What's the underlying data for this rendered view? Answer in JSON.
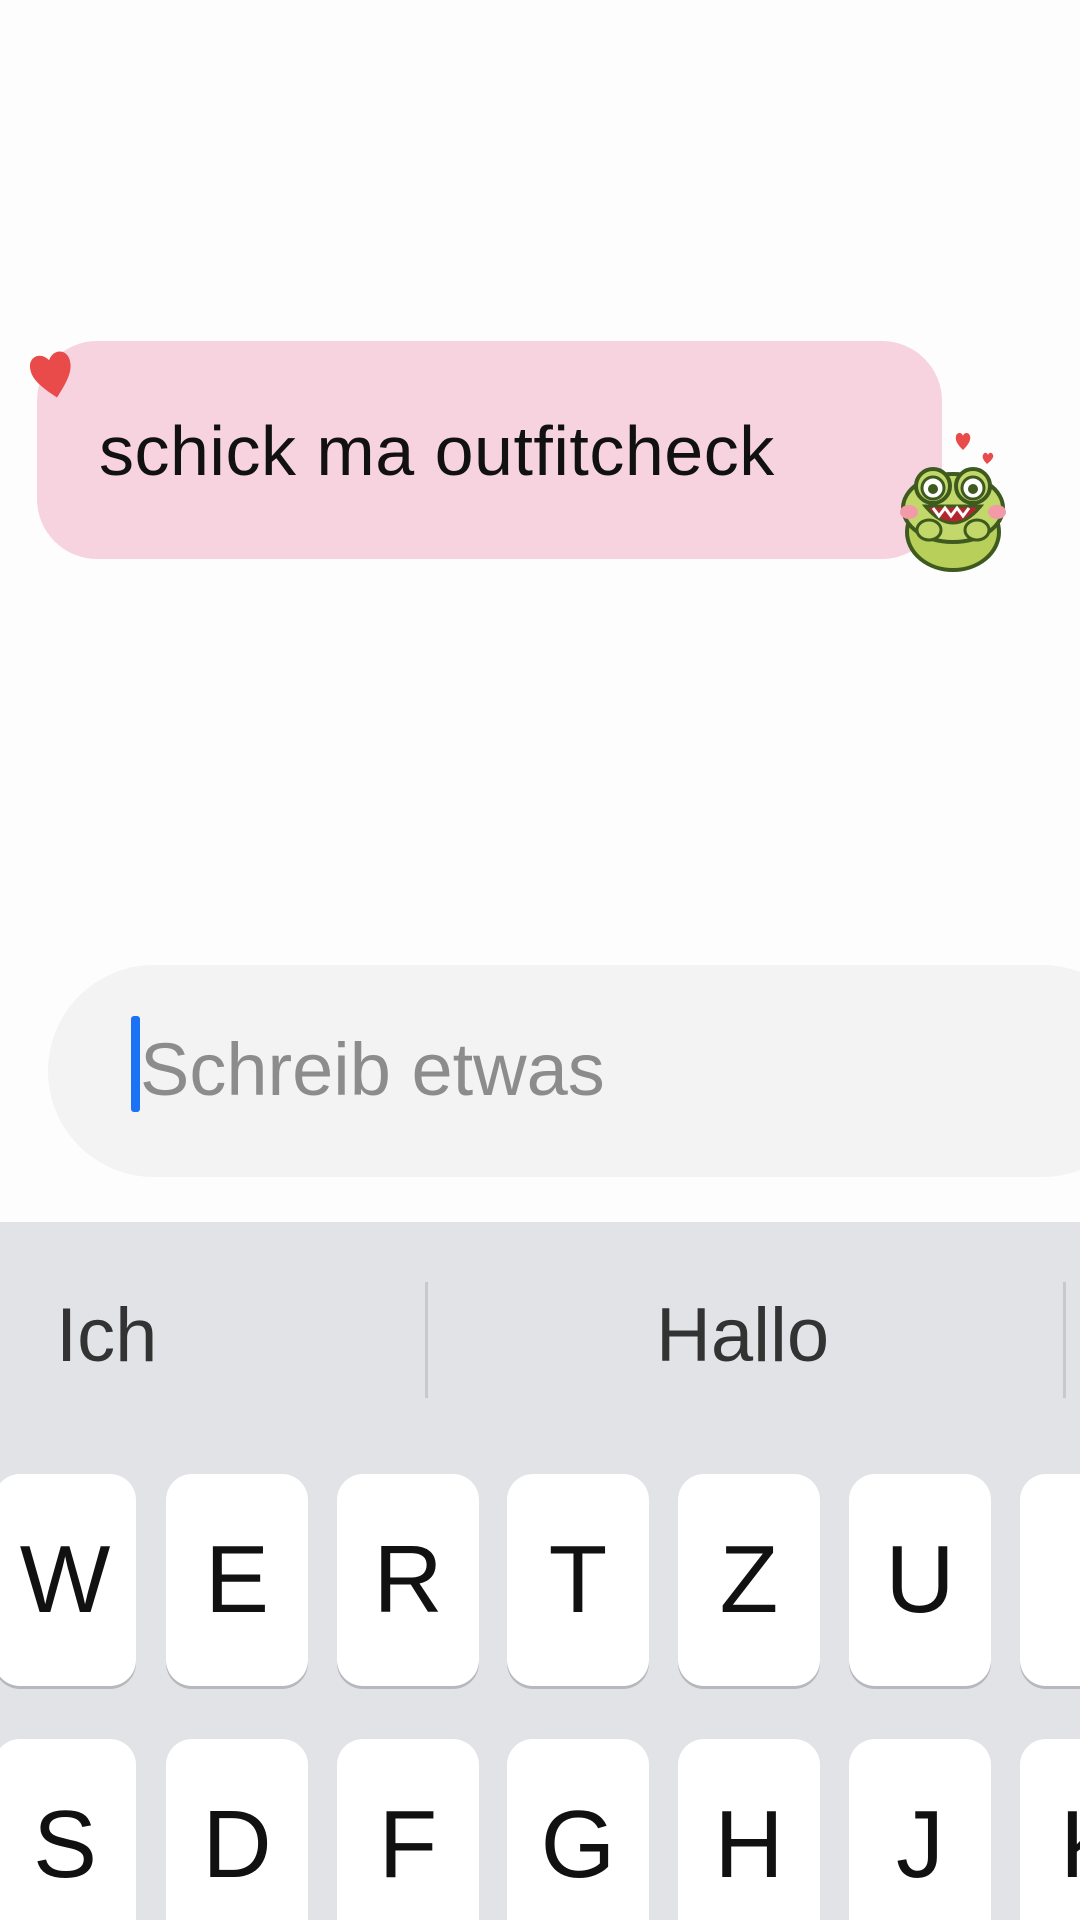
{
  "chat": {
    "message": "schick ma outfitcheck"
  },
  "composer": {
    "placeholder": "Schreib etwas"
  },
  "keyboard": {
    "suggestions": [
      "Ich",
      "Hallo"
    ],
    "row1": [
      "W",
      "E",
      "R",
      "T",
      "Z",
      "U",
      ""
    ],
    "row2": [
      "S",
      "D",
      "F",
      "G",
      "H",
      "J",
      "K"
    ]
  },
  "colors": {
    "bubble": "#f7d3e0",
    "caret": "#1a73f5",
    "heart": "#e94b4b",
    "keyboard_bg": "#e2e3e7"
  }
}
